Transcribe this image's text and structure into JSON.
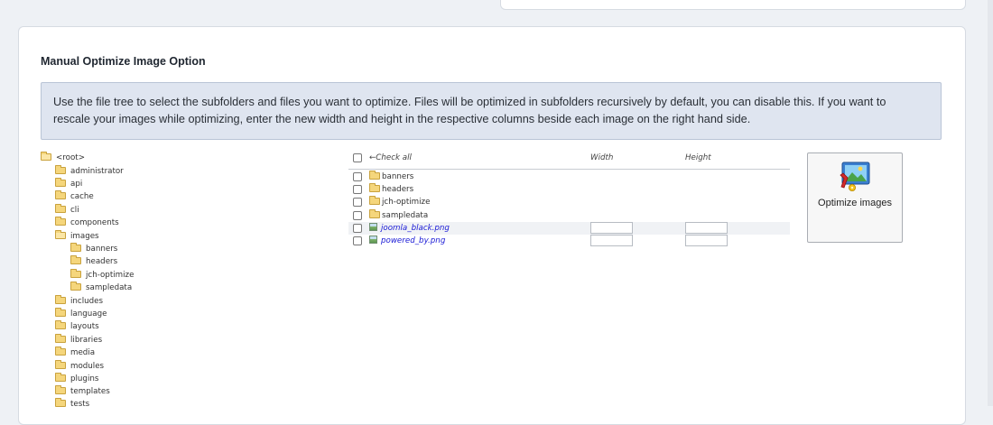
{
  "card": {
    "title": "Manual Optimize Image Option",
    "info_lines": [
      "Use the file tree to select the subfolders and files you want to optimize. Files will be optimized in subfolders recursively by default, you can disable this. If you want to",
      "rescale your images while optimizing, enter the new width and height in the respective columns beside each image on the right hand side."
    ]
  },
  "tree": {
    "root": "<root>",
    "folders": [
      "administrator",
      "api",
      "cache",
      "cli",
      "components",
      "images",
      "includes",
      "language",
      "layouts",
      "libraries",
      "media",
      "modules",
      "plugins",
      "templates",
      "tests"
    ],
    "images_children": [
      "banners",
      "headers",
      "jch-optimize",
      "sampledata"
    ]
  },
  "files": {
    "check_all": "Check all",
    "check_all_arrow": "←",
    "width_label": "Width",
    "height_label": "Height",
    "folders": [
      "banners",
      "headers",
      "jch-optimize",
      "sampledata"
    ],
    "images": [
      "joomla_black.png",
      "powered_by.png"
    ]
  },
  "optimize_button": {
    "label": "Optimize images",
    "icon": "image-wrench-icon"
  },
  "colors": {
    "page_bg": "#eef1f5",
    "info_bg": "#dfe5f0",
    "folder": "#f5d67c",
    "link": "#1a1ad6"
  }
}
